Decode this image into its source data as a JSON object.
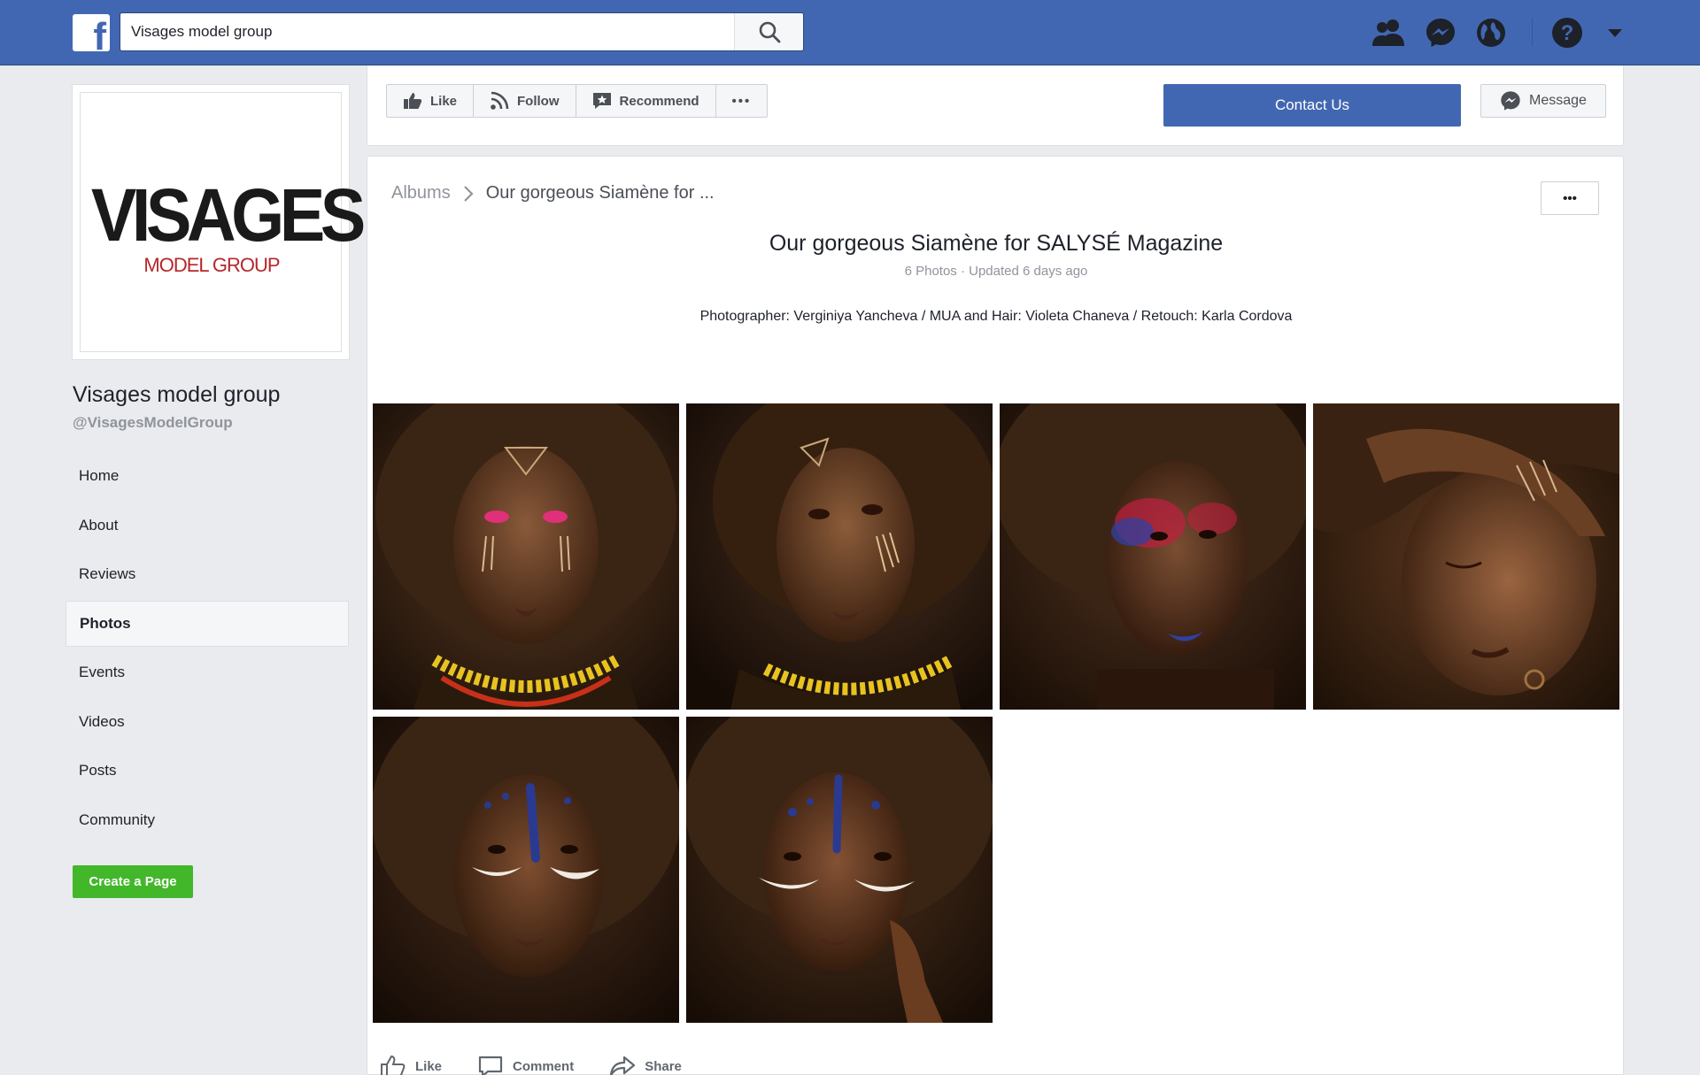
{
  "topbar": {
    "logo_letter": "f",
    "search_value": "Visages model group",
    "icons": [
      "search-icon",
      "friends-icon",
      "messenger-icon",
      "globe-icon",
      "help-icon",
      "caret-down-icon"
    ]
  },
  "profile": {
    "logo_main": "VISAGES",
    "logo_sub": "MODEL GROUP",
    "name": "Visages model group",
    "handle": "@VisagesModelGroup"
  },
  "nav": {
    "items": [
      "Home",
      "About",
      "Reviews",
      "Photos",
      "Events",
      "Videos",
      "Posts",
      "Community"
    ],
    "active": "Photos"
  },
  "create_page_label": "Create a Page",
  "actions": {
    "like": "Like",
    "follow": "Follow",
    "recommend": "Recommend",
    "more": "•••",
    "contact": "Contact Us",
    "message": "Message"
  },
  "album": {
    "breadcrumb_root": "Albums",
    "breadcrumb_current": "Our gorgeous Siamène for ...",
    "more_label": "•••",
    "title": "Our gorgeous Siamène for SALYSÉ Magazine",
    "meta": "6 Photos · Updated 6 days ago",
    "description": "Photographer: Verginiya Yancheva / MUA and Hair: Violeta Chaneva / Retouch: Karla Cordova",
    "photo_count": 6
  },
  "feedback": {
    "like": "Like",
    "comment": "Comment",
    "share": "Share"
  },
  "colors": {
    "brand_blue": "#4267b2",
    "create_green": "#42b72a",
    "logo_red": "#b5272a"
  }
}
